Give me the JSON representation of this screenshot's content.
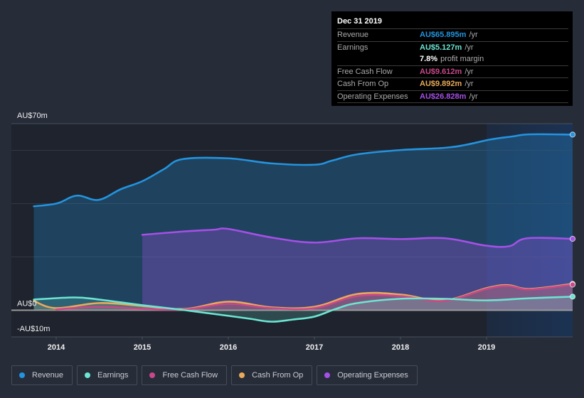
{
  "tooltip": {
    "date": "Dec 31 2019",
    "rows": [
      {
        "label": "Revenue",
        "value": "AU$65.895m",
        "unit": "/yr",
        "color": "#2394df"
      },
      {
        "label": "Earnings",
        "value": "AU$5.127m",
        "unit": "/yr",
        "color": "#6ce5d2"
      },
      {
        "label": "",
        "value": "7.8%",
        "unit": "profit margin",
        "color": "#ffffff"
      },
      {
        "label": "Free Cash Flow",
        "value": "AU$9.612m",
        "unit": "/yr",
        "color": "#c9488a"
      },
      {
        "label": "Cash From Op",
        "value": "AU$9.892m",
        "unit": "/yr",
        "color": "#eaaa5b"
      },
      {
        "label": "Operating Expenses",
        "value": "AU$26.828m",
        "unit": "/yr",
        "color": "#a550e6"
      }
    ]
  },
  "legend": [
    {
      "label": "Revenue",
      "color": "#2394df"
    },
    {
      "label": "Earnings",
      "color": "#6ce5d2"
    },
    {
      "label": "Free Cash Flow",
      "color": "#c9488a"
    },
    {
      "label": "Cash From Op",
      "color": "#eaaa5b"
    },
    {
      "label": "Operating Expenses",
      "color": "#a550e6"
    }
  ],
  "chart_data": {
    "type": "line",
    "title": "",
    "xlabel": "",
    "ylabel": "",
    "xlim": [
      2013.5,
      2020.05
    ],
    "ylim": [
      -10,
      70
    ],
    "y_tick_labels": [
      {
        "value": 70,
        "label": "AU$70m"
      },
      {
        "value": 0,
        "label": "AU$0"
      },
      {
        "value": -10,
        "label": "-AU$10m"
      }
    ],
    "y_gridlines": [
      60,
      40,
      20
    ],
    "x_ticks": [
      {
        "value": 2014,
        "label": "2014"
      },
      {
        "value": 2015,
        "label": "2015"
      },
      {
        "value": 2016,
        "label": "2016"
      },
      {
        "value": 2017,
        "label": "2017"
      },
      {
        "value": 2018,
        "label": "2018"
      },
      {
        "value": 2019,
        "label": "2019"
      }
    ],
    "highlight_range": [
      2019,
      2020
    ],
    "legend_position": "bottom-left",
    "series": [
      {
        "name": "Revenue",
        "color": "#2394df",
        "fill": "#2394df",
        "points": [
          [
            2013.74,
            39.0
          ],
          [
            2014.01,
            40.1
          ],
          [
            2014.24,
            43.0
          ],
          [
            2014.49,
            41.4
          ],
          [
            2014.75,
            45.4
          ],
          [
            2015.0,
            48.4
          ],
          [
            2015.25,
            52.9
          ],
          [
            2015.47,
            56.7
          ],
          [
            2016.0,
            57.0
          ],
          [
            2016.5,
            55.1
          ],
          [
            2017.0,
            54.6
          ],
          [
            2017.2,
            56.1
          ],
          [
            2017.5,
            58.5
          ],
          [
            2018.0,
            60.1
          ],
          [
            2018.5,
            60.9
          ],
          [
            2018.75,
            62.0
          ],
          [
            2019.05,
            64.1
          ],
          [
            2019.3,
            65.2
          ],
          [
            2019.5,
            66.0
          ],
          [
            2020.0,
            65.9
          ]
        ]
      },
      {
        "name": "Operating Expenses",
        "color": "#a550e6",
        "fill": "#a550e6",
        "points": [
          [
            2015.0,
            28.3
          ],
          [
            2015.5,
            29.6
          ],
          [
            2015.83,
            30.2
          ],
          [
            2016.0,
            30.5
          ],
          [
            2016.5,
            27.3
          ],
          [
            2017.0,
            25.4
          ],
          [
            2017.5,
            27.0
          ],
          [
            2018.0,
            26.7
          ],
          [
            2018.52,
            27.0
          ],
          [
            2018.98,
            24.3
          ],
          [
            2019.26,
            24.0
          ],
          [
            2019.47,
            27.0
          ],
          [
            2020.0,
            26.8
          ]
        ]
      },
      {
        "name": "Cash From Op",
        "color": "#eaaa5b",
        "fill": "#eaaa5b",
        "points": [
          [
            2013.74,
            3.5
          ],
          [
            2014.0,
            0.8
          ],
          [
            2014.5,
            2.7
          ],
          [
            2015.0,
            1.6
          ],
          [
            2015.5,
            0.5
          ],
          [
            2016.0,
            3.2
          ],
          [
            2016.5,
            1.1
          ],
          [
            2017.0,
            1.3
          ],
          [
            2017.5,
            6.1
          ],
          [
            2018.0,
            5.9
          ],
          [
            2018.5,
            3.7
          ],
          [
            2019.0,
            8.3
          ],
          [
            2019.25,
            9.4
          ],
          [
            2019.5,
            8.0
          ],
          [
            2020.0,
            9.9
          ]
        ]
      },
      {
        "name": "Free Cash Flow",
        "color": "#c9488a",
        "fill": "#c9488a",
        "points": [
          [
            2014.0,
            0.3
          ],
          [
            2014.5,
            1.3
          ],
          [
            2015.0,
            0.5
          ],
          [
            2015.5,
            0.3
          ],
          [
            2016.0,
            2.4
          ],
          [
            2016.5,
            0.8
          ],
          [
            2017.0,
            0.8
          ],
          [
            2017.5,
            5.3
          ],
          [
            2018.0,
            5.3
          ],
          [
            2018.5,
            3.5
          ],
          [
            2019.0,
            8.0
          ],
          [
            2019.25,
            9.1
          ],
          [
            2019.5,
            7.8
          ],
          [
            2020.0,
            9.6
          ]
        ]
      },
      {
        "name": "Earnings",
        "color": "#6ce5d2",
        "fill": "#6ce5d2",
        "points": [
          [
            2013.74,
            4.0
          ],
          [
            2014.21,
            4.8
          ],
          [
            2014.5,
            4.0
          ],
          [
            2015.0,
            1.9
          ],
          [
            2015.5,
            0.0
          ],
          [
            2016.0,
            -2.1
          ],
          [
            2016.25,
            -3.2
          ],
          [
            2016.5,
            -4.3
          ],
          [
            2016.75,
            -3.5
          ],
          [
            2017.0,
            -2.4
          ],
          [
            2017.25,
            0.5
          ],
          [
            2017.5,
            2.7
          ],
          [
            2018.0,
            4.3
          ],
          [
            2018.5,
            4.3
          ],
          [
            2019.0,
            3.7
          ],
          [
            2019.5,
            4.5
          ],
          [
            2020.0,
            5.1
          ]
        ]
      }
    ]
  }
}
